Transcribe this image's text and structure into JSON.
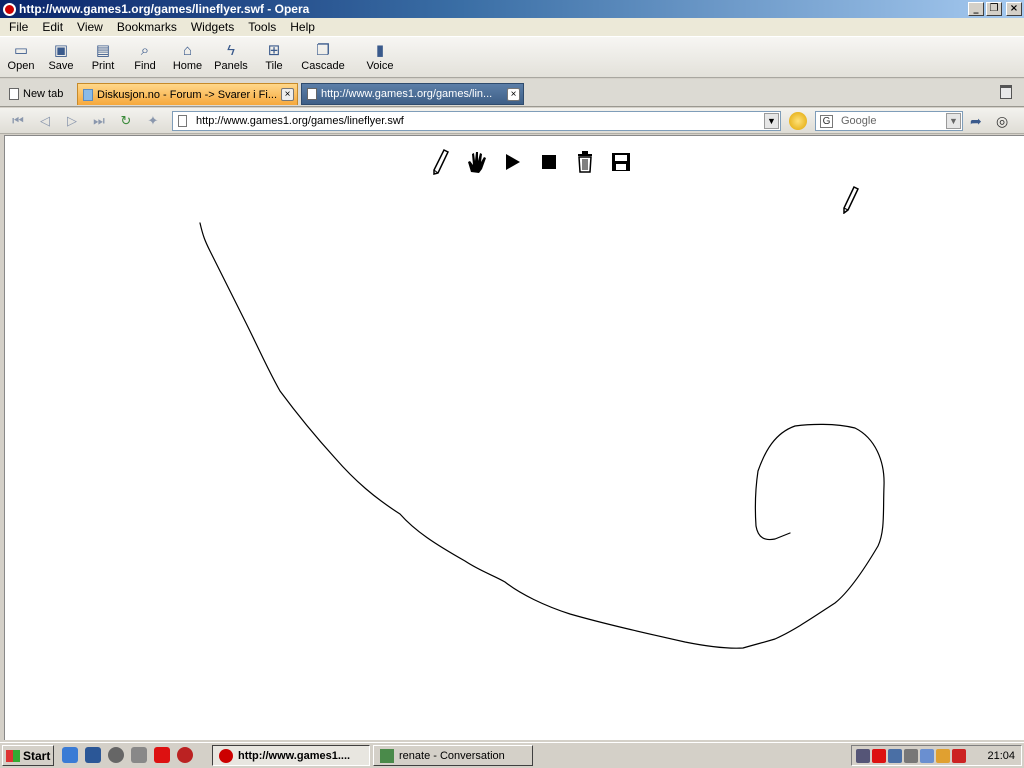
{
  "window": {
    "title": "http://www.games1.org/games/lineflyer.swf - Opera",
    "minimize": "_",
    "restore": "❐",
    "close": "×"
  },
  "menu": [
    "File",
    "Edit",
    "View",
    "Bookmarks",
    "Widgets",
    "Tools",
    "Help"
  ],
  "toolbar": {
    "open": "Open",
    "save": "Save",
    "print": "Print",
    "find": "Find",
    "home": "Home",
    "panels": "Panels",
    "tile": "Tile",
    "cascade": "Cascade",
    "voice": "Voice"
  },
  "tabs": {
    "new_tab": "New tab",
    "forum": "Diskusjon.no - Forum -> Svarer i Fi...",
    "game": "http://www.games1.org/games/lin...",
    "close": "×"
  },
  "address": {
    "url": "http://www.games1.org/games/lineflyer.swf",
    "search_placeholder": "Google",
    "search_engine_letter": "G"
  },
  "taskbar": {
    "start": "Start",
    "tasks": [
      "http://www.games1....",
      "renate - Conversation"
    ],
    "clock": "21:04"
  },
  "colors": {
    "title_gradient_start": "#0a246a",
    "active_tab": "#f6a83c",
    "line": "#000000"
  }
}
